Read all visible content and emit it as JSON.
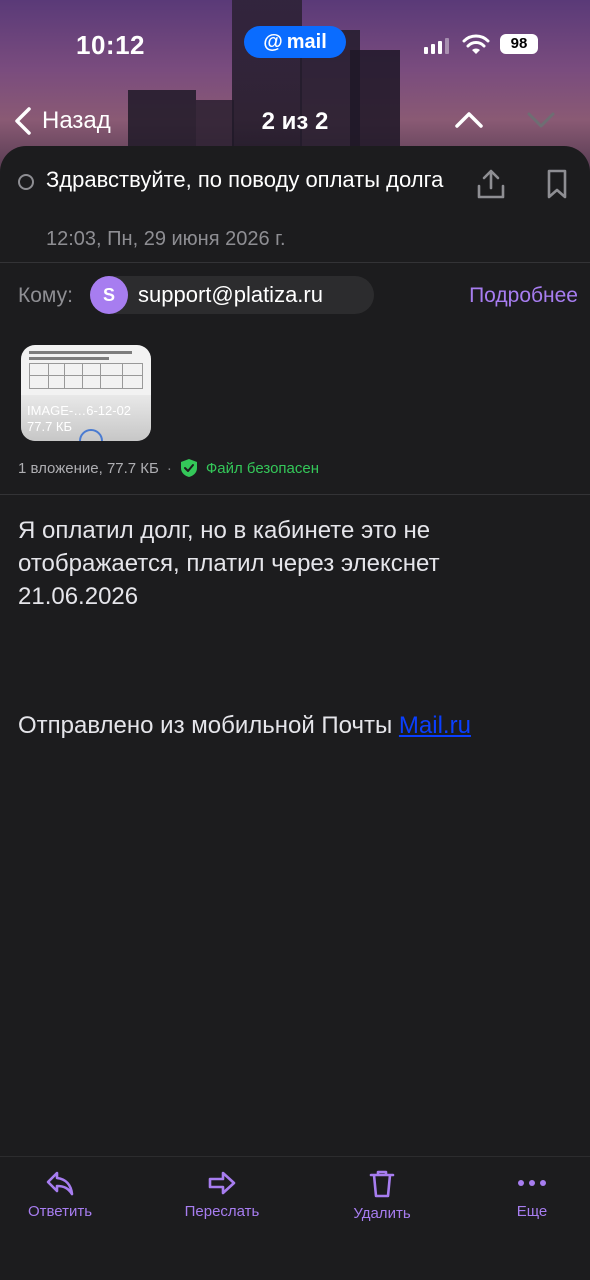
{
  "status_bar": {
    "time": "10:12",
    "app_pill": "mail",
    "battery": "98"
  },
  "nav": {
    "back_label": "Назад",
    "counter": "2 из 2"
  },
  "message": {
    "subject": "Здравствуйте, по поводу оплаты долга",
    "date": "12:03, Пн, 29 июня 2026 г.",
    "to_label": "Кому:",
    "recipient_initial": "S",
    "recipient": "support@platiza.ru",
    "more_link": "Подробнее",
    "body": "Я оплатил долг, но в кабинете это не отображается, платил через элекснет 21.06.2026",
    "signature_prefix": "Отправлено из мобильной Почты ",
    "signature_link": "Mail.ru"
  },
  "attachment": {
    "name": "IMAGE-…6-12-02",
    "size": "77.7 КБ",
    "summary": "1 вложение, 77.7 КБ",
    "separator": "·",
    "safe_status": "Файл безопасен"
  },
  "toolbar": {
    "reply": "Ответить",
    "forward": "Переслать",
    "delete": "Удалить",
    "more": "Еще"
  },
  "colors": {
    "accent": "#a77df0",
    "safe": "#34c759",
    "background": "#1c1c1e",
    "link": "#0a3fff"
  }
}
